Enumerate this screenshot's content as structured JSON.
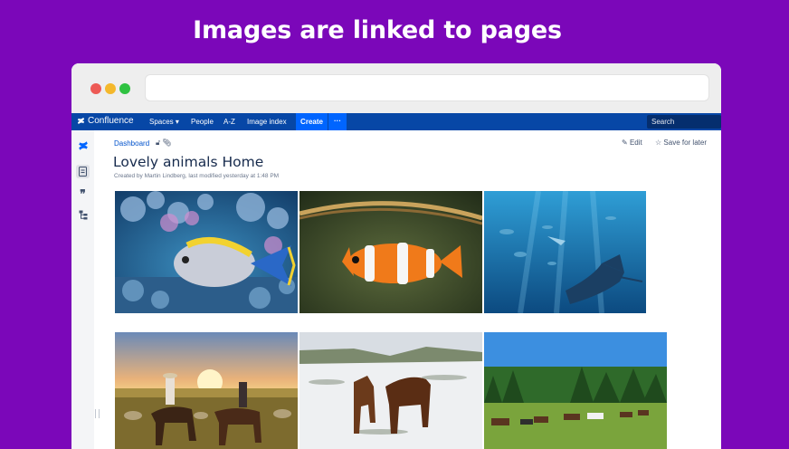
{
  "headline": "Images are linked to pages",
  "nav": {
    "brand": "Confluence",
    "spaces": "Spaces",
    "people": "People",
    "az": "A-Z",
    "image_index": "Image index",
    "create": "Create",
    "more": "···",
    "search_placeholder": "Search"
  },
  "page": {
    "breadcrumb": "Dashboard",
    "edit": "Edit",
    "save_for_later": "Save for later",
    "title": "Lovely animals Home",
    "byline": "Created by Martin Lindberg, last modified yesterday at 1:48 PM"
  },
  "images": [
    {
      "subject": "tang fish on coral reef"
    },
    {
      "subject": "clownfish"
    },
    {
      "subject": "manta ray underwater"
    },
    {
      "subject": "cowboys riding horses at sunset"
    },
    {
      "subject": "two brown horses in snow"
    },
    {
      "subject": "herd of horses grazing by forest"
    }
  ],
  "colors": {
    "background": "#7b07b9",
    "nav": "#0747a6",
    "create_button": "#0065ff",
    "link": "#0052cc"
  }
}
